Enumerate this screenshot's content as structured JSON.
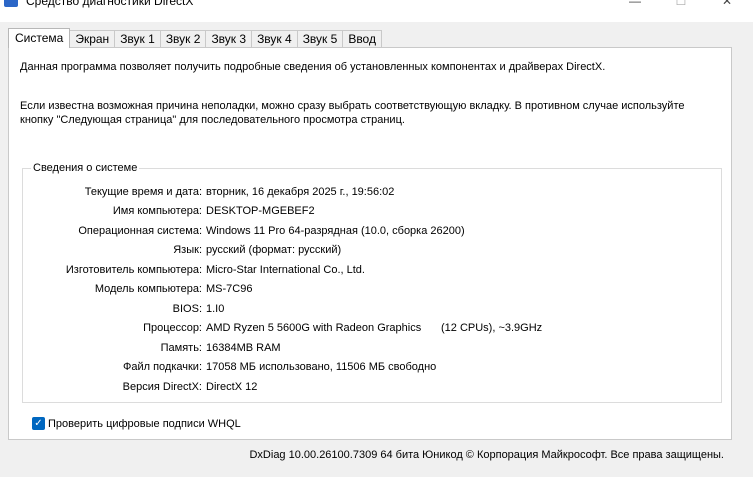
{
  "window": {
    "title": "Средство диагностики DirectX",
    "minimize_glyph": "—",
    "maximize_glyph": "☐",
    "close_glyph": "✕",
    "icon": "directx-app-icon"
  },
  "tabs": [
    {
      "label": "Система",
      "active": true
    },
    {
      "label": "Экран",
      "active": false
    },
    {
      "label": "Звук 1",
      "active": false
    },
    {
      "label": "Звук 2",
      "active": false
    },
    {
      "label": "Звук 3",
      "active": false
    },
    {
      "label": "Звук 4",
      "active": false
    },
    {
      "label": "Звук 5",
      "active": false
    },
    {
      "label": "Ввод",
      "active": false
    }
  ],
  "intro": {
    "line1": "Данная программа позволяет получить подробные сведения об установленных компонентах и драйверах DirectX.",
    "line2": "Если известна возможная причина неполадки, можно сразу выбрать соответствующую вкладку. В противном случае используйте кнопку \"Следующая страница\" для последовательного просмотра страниц."
  },
  "system_info": {
    "group_title": "Сведения о системе",
    "rows": [
      {
        "label": "Текущие время и дата:",
        "value": "вторник, 16 декабря 2025 г., 19:56:02"
      },
      {
        "label": "Имя компьютера:",
        "value": "DESKTOP-MGEBEF2"
      },
      {
        "label": "Операционная система:",
        "value": "Windows 11 Pro 64-разрядная (10.0, сборка 26200)"
      },
      {
        "label": "Язык:",
        "value": "русский (формат: русский)"
      },
      {
        "label": "Изготовитель компьютера:",
        "value": "Micro-Star International Co., Ltd."
      },
      {
        "label": "Модель компьютера:",
        "value": "MS-7C96"
      },
      {
        "label": "BIOS:",
        "value": "1.I0"
      },
      {
        "label": "Процессор:",
        "value": "AMD Ryzen 5 5600G with Radeon Graphics",
        "extra": "(12 CPUs), ~3.9GHz"
      },
      {
        "label": "Память:",
        "value": "16384MB RAM"
      },
      {
        "label": "Файл подкачки:",
        "value": "17058 МБ использовано, 11506 МБ свободно"
      },
      {
        "label": "Версия DirectX:",
        "value": "DirectX 12"
      }
    ]
  },
  "whql": {
    "label": "Проверить цифровые подписи WHQL",
    "checked": true,
    "check_glyph": "✓"
  },
  "footer": {
    "text": "DxDiag 10.00.26100.7309 64 бита Юникод © Корпорация Майкрософт. Все права защищены."
  },
  "colors": {
    "accent": "#0067c0",
    "panel_bg": "#ffffff",
    "window_bg": "#f0f0f0"
  }
}
